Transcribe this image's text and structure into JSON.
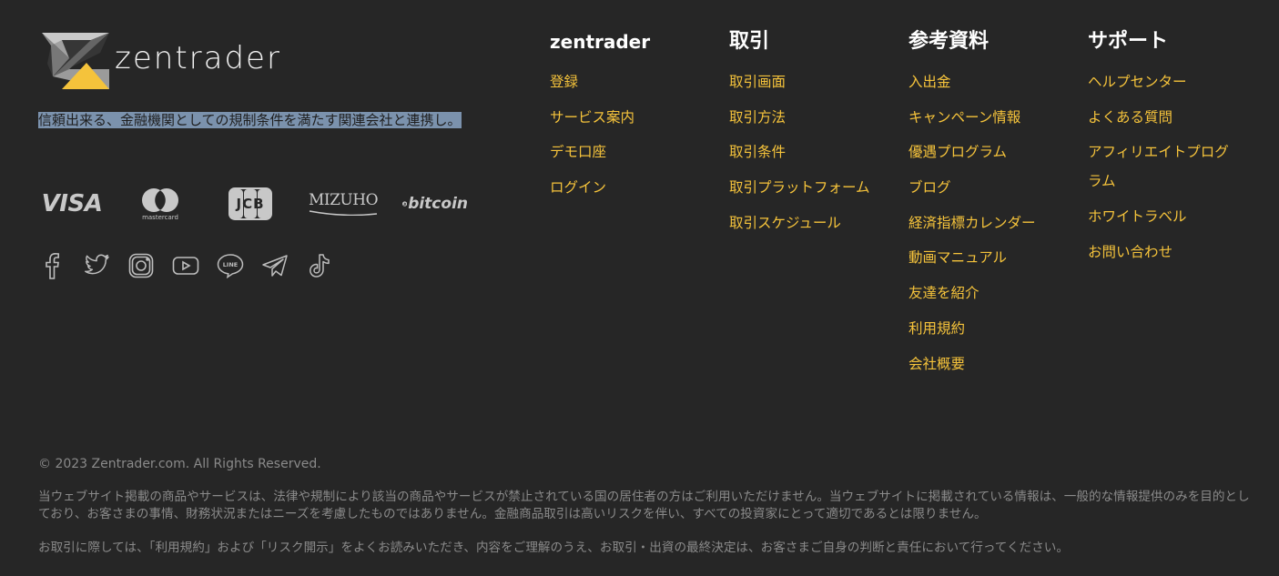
{
  "brand": {
    "name": "zentrader",
    "tagline": "信頼出来る、金融機関としての規制条件を満たす関連会社と連携し。"
  },
  "payments": {
    "visa": "VISA",
    "mastercard": "mastercard",
    "jcb": "JCB",
    "mizuho": "MIZUHO",
    "bitcoin": "bitcoin"
  },
  "social": [
    "facebook-icon",
    "twitter-icon",
    "instagram-icon",
    "youtube-icon",
    "line-icon",
    "telegram-icon",
    "tiktok-icon"
  ],
  "columns": [
    {
      "title": "zentrader",
      "items": [
        "登録",
        "サービス案内",
        "デモ口座",
        "ログイン"
      ]
    },
    {
      "title": "取引",
      "items": [
        "取引画面",
        "取引方法",
        "取引条件",
        "取引プラットフォーム",
        "取引スケジュール"
      ]
    },
    {
      "title": "参考資料",
      "items": [
        "入出金",
        "キャンペーン情報",
        "優遇プログラム",
        "ブログ",
        "経済指標カレンダー",
        "動画マニュアル",
        "友達を紹介",
        "利用規約",
        "会社概要"
      ]
    },
    {
      "title": "サポート",
      "items": [
        "ヘルプセンター",
        "よくある質問",
        "アフィリエイトプログラム",
        "ホワイトラベル",
        "お問い合わせ"
      ]
    }
  ],
  "footer": {
    "copyright": "© 2023 Zentrader.com. All Rights Reserved.",
    "disclaimer_1": "当ウェブサイト掲載の商品やサービスは、法律や規制により該当の商品やサービスが禁止されている国の居住者の方はご利用いただけません。当ウェブサイトに掲載されている情報は、一般的な情報提供のみを目的としており、お客さまの事情、財務状況またはニーズを考慮したものではありません。金融商品取引は高いリスクを伴い、すべての投資家にとって適切であるとは限りません。",
    "disclaimer_2": "お取引に際しては、「利用規約」および「リスク開示」をよくお読みいただき、内容をご理解のうえ、お取引・出資の最終決定は、お客さまご自身の判断と責任において行ってください。"
  },
  "colors": {
    "background": "#262626",
    "link": "#f5c33b",
    "heading": "#ffffff",
    "muted": "#8a8a8a",
    "selection": "#7b92ad"
  }
}
